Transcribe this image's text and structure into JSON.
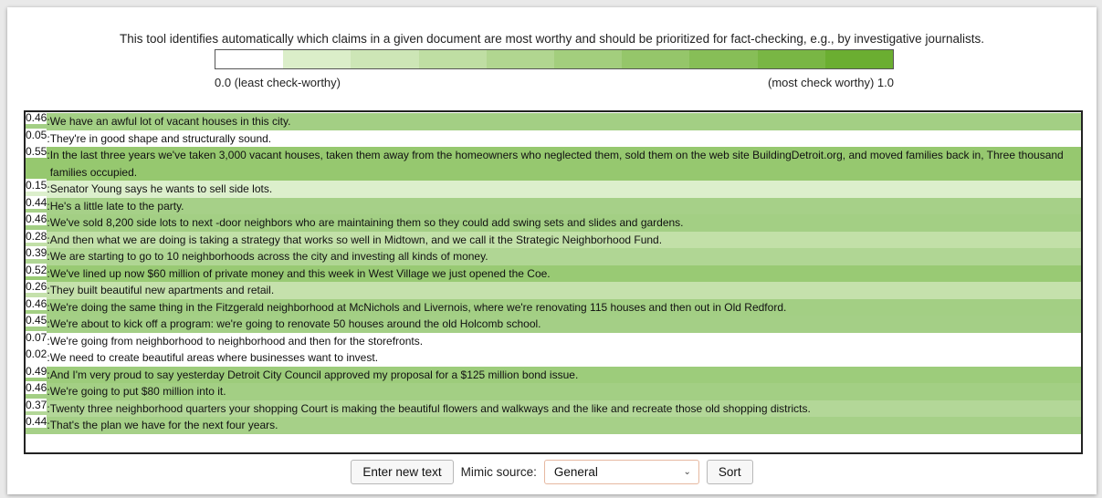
{
  "intro": "This tool identifies automatically which claims in a given document are most worthy and should be prioritized for fact-checking, e.g., by investigative journalists.",
  "scale": {
    "colors": [
      "#ffffff",
      "#dbeec9",
      "#cde6b6",
      "#bfdea3",
      "#b1d690",
      "#a3ce7d",
      "#95c66a",
      "#87be57",
      "#79b644",
      "#6bae31"
    ],
    "left_label": "0.0 (least check-worthy)",
    "right_label": "(most check worthy) 1.0"
  },
  "document": {
    "sentences": [
      {
        "score": "0.46",
        "text": "We have an awful lot of vacant houses in this city.",
        "color": "#a3cf84"
      },
      {
        "score": "0.05",
        "text": "They're in good shape and structurally sound.",
        "color": "#ffffff"
      },
      {
        "score": "0.55",
        "text": "In the last three years we've taken 3,000 vacant houses, taken them away from the homeowners who neglected them, sold them on the web site BuildingDetroit.org, and moved families back in, Three thousand families occupied.",
        "color": "#96c86f"
      },
      {
        "score": "0.15",
        "text": "Senator Young says he wants to sell side lots.",
        "color": "#dcefcc"
      },
      {
        "score": "0.44",
        "text": "He's a little late to the party.",
        "color": "#a6d088"
      },
      {
        "score": "0.46",
        "text": "We've sold 8,200 side lots to next -door neighbors who are maintaining them so they could add swing sets and slides and gardens.",
        "color": "#a3cf84"
      },
      {
        "score": "0.28",
        "text": "And then what we are doing is taking a strategy that works so well in Midtown, and we call it the Strategic Neighborhood Fund.",
        "color": "#c2e0a8"
      },
      {
        "score": "0.39",
        "text": "We are starting to go to 10 neighborhoods across the city and investing all kinds of money.",
        "color": "#b0d694"
      },
      {
        "score": "0.52",
        "text": "We've lined up now $60 million of private money and this week in West Village we just opened the Coe.",
        "color": "#99ca74"
      },
      {
        "score": "0.26",
        "text": "They built beautiful new apartments and retail.",
        "color": "#c5e1ac"
      },
      {
        "score": "0.46",
        "text": "We're doing the same thing in the Fitzgerald neighborhood at McNichols and Livernois, where we're renovating 115 houses and then out in Old Redford.",
        "color": "#a3cf84"
      },
      {
        "score": "0.45",
        "text": "We're about to kick off a program: we're going to renovate 50 houses around the old Holcomb school.",
        "color": "#a4cf86"
      },
      {
        "score": "0.07",
        "text": "We're going from neighborhood to neighborhood and then for the storefronts.",
        "color": "#ffffff"
      },
      {
        "score": "0.02",
        "text": "We need to create beautiful areas where businesses want to invest.",
        "color": "#ffffff"
      },
      {
        "score": "0.49",
        "text": "And I'm very proud to say yesterday Detroit City Council approved my proposal for a $125 million bond issue.",
        "color": "#9dcc7b"
      },
      {
        "score": "0.46",
        "text": "We're going to put $80 million into it.",
        "color": "#a3cf84"
      },
      {
        "score": "0.37",
        "text": "Twenty three neighborhood quarters your shopping Court is making the beautiful flowers and walkways and the like and recreate those old shopping districts.",
        "color": "#b3d798"
      },
      {
        "score": "0.44",
        "text": "That's the plan we have for the next four years.",
        "color": "#a6d088"
      }
    ]
  },
  "controls": {
    "enter_button": "Enter new text",
    "mimic_label": "Mimic source:",
    "mimic_value": "General",
    "sort_button": "Sort"
  }
}
